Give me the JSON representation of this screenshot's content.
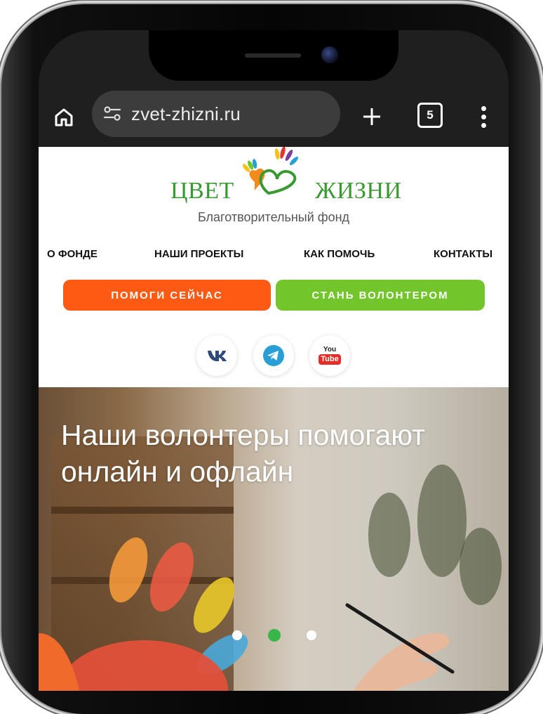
{
  "browser": {
    "url": "zvet-zhizni.ru",
    "tab_count": "5"
  },
  "header": {
    "logo_left": "ЦВЕТ",
    "logo_right": "ЖИЗНИ",
    "tagline": "Благотворительный фонд"
  },
  "nav": {
    "items": [
      {
        "label": "О ФОНДЕ"
      },
      {
        "label": "НАШИ ПРОЕКТЫ"
      },
      {
        "label": "КАК ПОМОЧЬ"
      },
      {
        "label": "КОНТАКТЫ"
      }
    ]
  },
  "cta": {
    "help_label": "ПОМОГИ СЕЙЧАС",
    "volunteer_label": "СТАНЬ ВОЛОНТЕРОМ"
  },
  "social": {
    "vk": "vk-icon",
    "telegram": "telegram-icon",
    "youtube": "youtube-icon",
    "youtube_label_top": "You",
    "youtube_label_bottom": "Tube"
  },
  "hero": {
    "title": "Наши волонтеры помогают онлайн и офлайн",
    "slides": 3,
    "active_slide": 2
  },
  "colors": {
    "brand_green": "#3a9a32",
    "help_orange": "#ff5a14",
    "volunteer_green": "#72c52b",
    "active_dot": "#3ab54a"
  }
}
